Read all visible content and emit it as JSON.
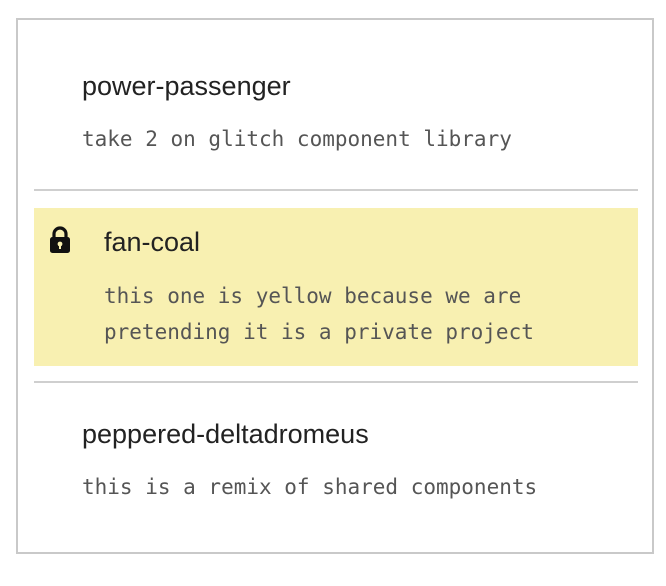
{
  "projects": [
    {
      "name": "power-passenger",
      "description": "take 2 on glitch component library",
      "private": false
    },
    {
      "name": "fan-coal",
      "description_lines": [
        "this one is yellow because we are",
        "pretending it is a private project"
      ],
      "private": true,
      "icon": "lock-icon",
      "highlight_color": "#f8f0b1"
    },
    {
      "name": "peppered-deltadromeus",
      "description": "this is a remix of shared components",
      "private": false
    }
  ]
}
